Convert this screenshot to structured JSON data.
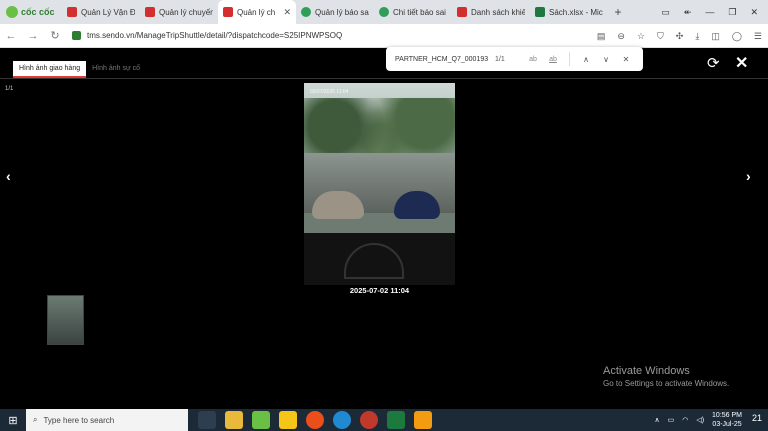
{
  "browser": {
    "brand": "cốc cốc",
    "tabs": [
      {
        "label": "Quản Lý Vận Đơ",
        "icon": "sendo-icon",
        "active": false
      },
      {
        "label": "Quản lý chuyến",
        "icon": "sendo-icon",
        "active": false
      },
      {
        "label": "Quản lý ch",
        "icon": "sendo-icon",
        "active": true
      },
      {
        "label": "Quản lý báo sai",
        "icon": "green-circle-icon",
        "active": false
      },
      {
        "label": "Chi tiết báo sai",
        "icon": "green-circle-icon",
        "active": false
      },
      {
        "label": "Danh sách khiếu",
        "icon": "sendo-icon",
        "active": false
      },
      {
        "label": "Sách.xlsx - Micro",
        "icon": "excel-icon",
        "active": false
      }
    ],
    "url": "tms.sendo.vn/ManageTripShuttle/detail/?dispatchcode=S25IPNWPSOQ"
  },
  "findbar": {
    "query": "PARTNER_HCM_Q7_000193",
    "count": "1/1",
    "match_case": "ab",
    "whole_word": "ab"
  },
  "viewer": {
    "tabs": [
      {
        "label": "Hình ảnh giao hàng",
        "active": true
      },
      {
        "label": "Hình ảnh sự cố",
        "active": false
      }
    ],
    "counter": "1/1",
    "timestamp": "2025-07-02 11:04",
    "photo_stamp": "02/07/2025 11:04"
  },
  "watermark": {
    "title": "Activate Windows",
    "subtitle": "Go to Settings to activate Windows."
  },
  "taskbar": {
    "search_placeholder": "Type here to search",
    "time": "10:56 PM",
    "date": "03-Jul-25",
    "notifications": "21"
  },
  "colors": {
    "accent": "#e53935",
    "brand_green": "#6abf45",
    "taskbar": "#1c2a38"
  }
}
